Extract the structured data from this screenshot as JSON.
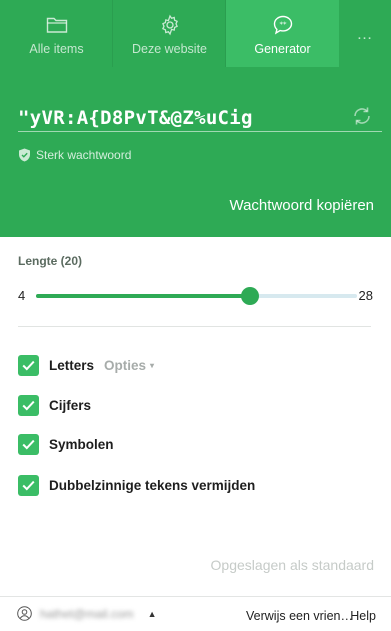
{
  "tabs": [
    {
      "label": "Alle items",
      "icon": "folder-icon",
      "active": false
    },
    {
      "label": "Deze website",
      "icon": "gear-icon",
      "active": false
    },
    {
      "label": "Generator",
      "icon": "chat-bubble-icon",
      "active": true
    },
    {
      "label": "…",
      "icon": "more-icon",
      "active": false
    }
  ],
  "generator": {
    "password": "\"yVR:A{D8PvT&@Z%uCig",
    "strength": "Sterk wachtwoord",
    "copy_label": "Wachtwoord kopiëren",
    "refresh_icon": "refresh-icon"
  },
  "length": {
    "label": "Lengte (20)",
    "min": "4",
    "max": "28",
    "value": 20,
    "range": [
      4,
      28
    ]
  },
  "options": [
    {
      "label": "Letters",
      "checked": true,
      "extra": "Opties",
      "extra_caret": "▾"
    },
    {
      "label": "Cijfers",
      "checked": true
    },
    {
      "label": "Symbolen",
      "checked": true
    },
    {
      "label": "Dubbelzinnige tekens vermijden",
      "checked": true
    }
  ],
  "saved_default": "Opgeslagen als standaard",
  "footer": {
    "account_email": "hathet@mail.com",
    "account_caret": "▲",
    "refer": "Verwijs een vrien…",
    "help": "Help"
  },
  "colors": {
    "brand_green": "#2eaa55",
    "active_tab_green": "#3bbd66",
    "slider_track": "#d7e9ef"
  }
}
